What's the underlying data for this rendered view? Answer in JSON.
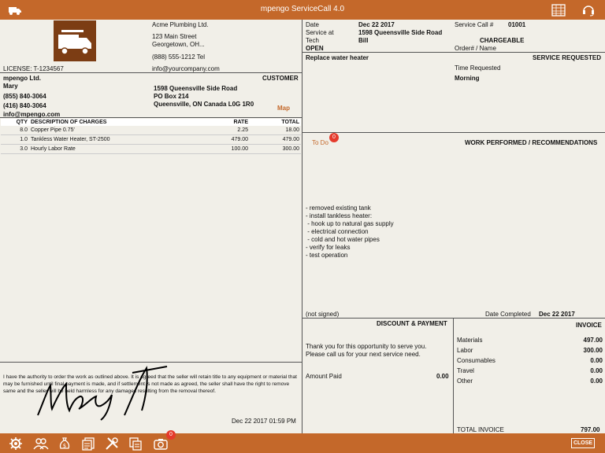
{
  "app": {
    "title": "mpengo ServiceCall 4.0"
  },
  "company": {
    "name": "Acme Plumbing Ltd.",
    "address1": "123 Main Street",
    "address2": "Georgetown, OH...",
    "phone": "(888) 555-1212 Tel",
    "email": "info@yourcompany.com",
    "license": "LICENSE: T-1234567"
  },
  "call": {
    "date_label": "Date",
    "date": "Dec 22 2017",
    "service_call_label": "Service Call #",
    "service_call": "01001",
    "service_at_label": "Service at",
    "service_at": "1598 Queensville Side Road",
    "tech_label": "Tech",
    "tech": "Bill",
    "chargeable": "CHARGEABLE",
    "status": "OPEN",
    "order_label": "Order# / Name"
  },
  "customer": {
    "section_label": "CUSTOMER",
    "name": "mpengo Ltd.",
    "contact": "Mary",
    "phone1": "(855) 840-3064",
    "phone2": "(416) 840-3064",
    "email": "info@mpengo.com",
    "address1": "1598 Queensville Side Road",
    "address2": "PO Box 214",
    "address3": "Queensville, ON Canada L0G 1R0",
    "map_link": "Map"
  },
  "service": {
    "requested_label": "SERVICE REQUESTED",
    "requested": "Replace water heater",
    "time_label": "Time Requested",
    "time": "Morning"
  },
  "charges": {
    "headers": {
      "qty": "QTY",
      "desc": "DESCRIPTION OF CHARGES",
      "rate": "RATE",
      "total": "TOTAL"
    },
    "rows": [
      {
        "qty": "8.0",
        "desc": "Copper Pipe 0.75'",
        "rate": "2.25",
        "total": "18.00"
      },
      {
        "qty": "1.0",
        "desc": "Tankless Water Heater, ST-2500",
        "rate": "479.00",
        "total": "479.00"
      },
      {
        "qty": "3.0",
        "desc": "Hourly Labor Rate",
        "rate": "100.00",
        "total": "300.00"
      }
    ]
  },
  "work": {
    "todo_label": "To Do",
    "todo_count": "0",
    "section_label": "WORK PERFORMED / RECOMMENDATIONS",
    "lines": [
      "- removed existing tank",
      "- install tankless heater:",
      " - hook up to natural gas supply",
      " - electrical connection",
      " - cold and hot water pipes",
      "- verify for leaks",
      "- test operation"
    ],
    "signed_status": "(not signed)",
    "completed_label": "Date Completed",
    "completed_date": "Dec 22 2017"
  },
  "authorization": {
    "text": "I have the authority to order the work as outlined above.  It is agreed that the seller will retain title to any equipment or material that may be furnished until final payment is made, and if settlement is not made as agreed, the seller shall have the right to remove same and the seller will be held harmless for any damages resulting from the removal thereof.",
    "signature_date": "Dec 22 2017 01:59 PM"
  },
  "payment": {
    "section_label": "DISCOUNT & PAYMENT",
    "thank_you": "Thank you for this opportunity to serve you. Please call us for your next service need.",
    "amount_paid_label": "Amount Paid",
    "amount_paid": "0.00"
  },
  "invoice": {
    "section_label": "INVOICE",
    "rows": [
      {
        "label": "Materials",
        "value": "497.00"
      },
      {
        "label": "Labor",
        "value": "300.00"
      },
      {
        "label": "Consumables",
        "value": "0.00"
      },
      {
        "label": "Travel",
        "value": "0.00"
      },
      {
        "label": "Other",
        "value": "0.00"
      }
    ],
    "total_label": "TOTAL INVOICE",
    "total": "797.00"
  },
  "toolbar": {
    "close_label": "CLOSE",
    "camera_badge": "0"
  },
  "colors": {
    "accent": "#c4682a",
    "background": "#f1efe8",
    "badge": "#e53b2c"
  }
}
